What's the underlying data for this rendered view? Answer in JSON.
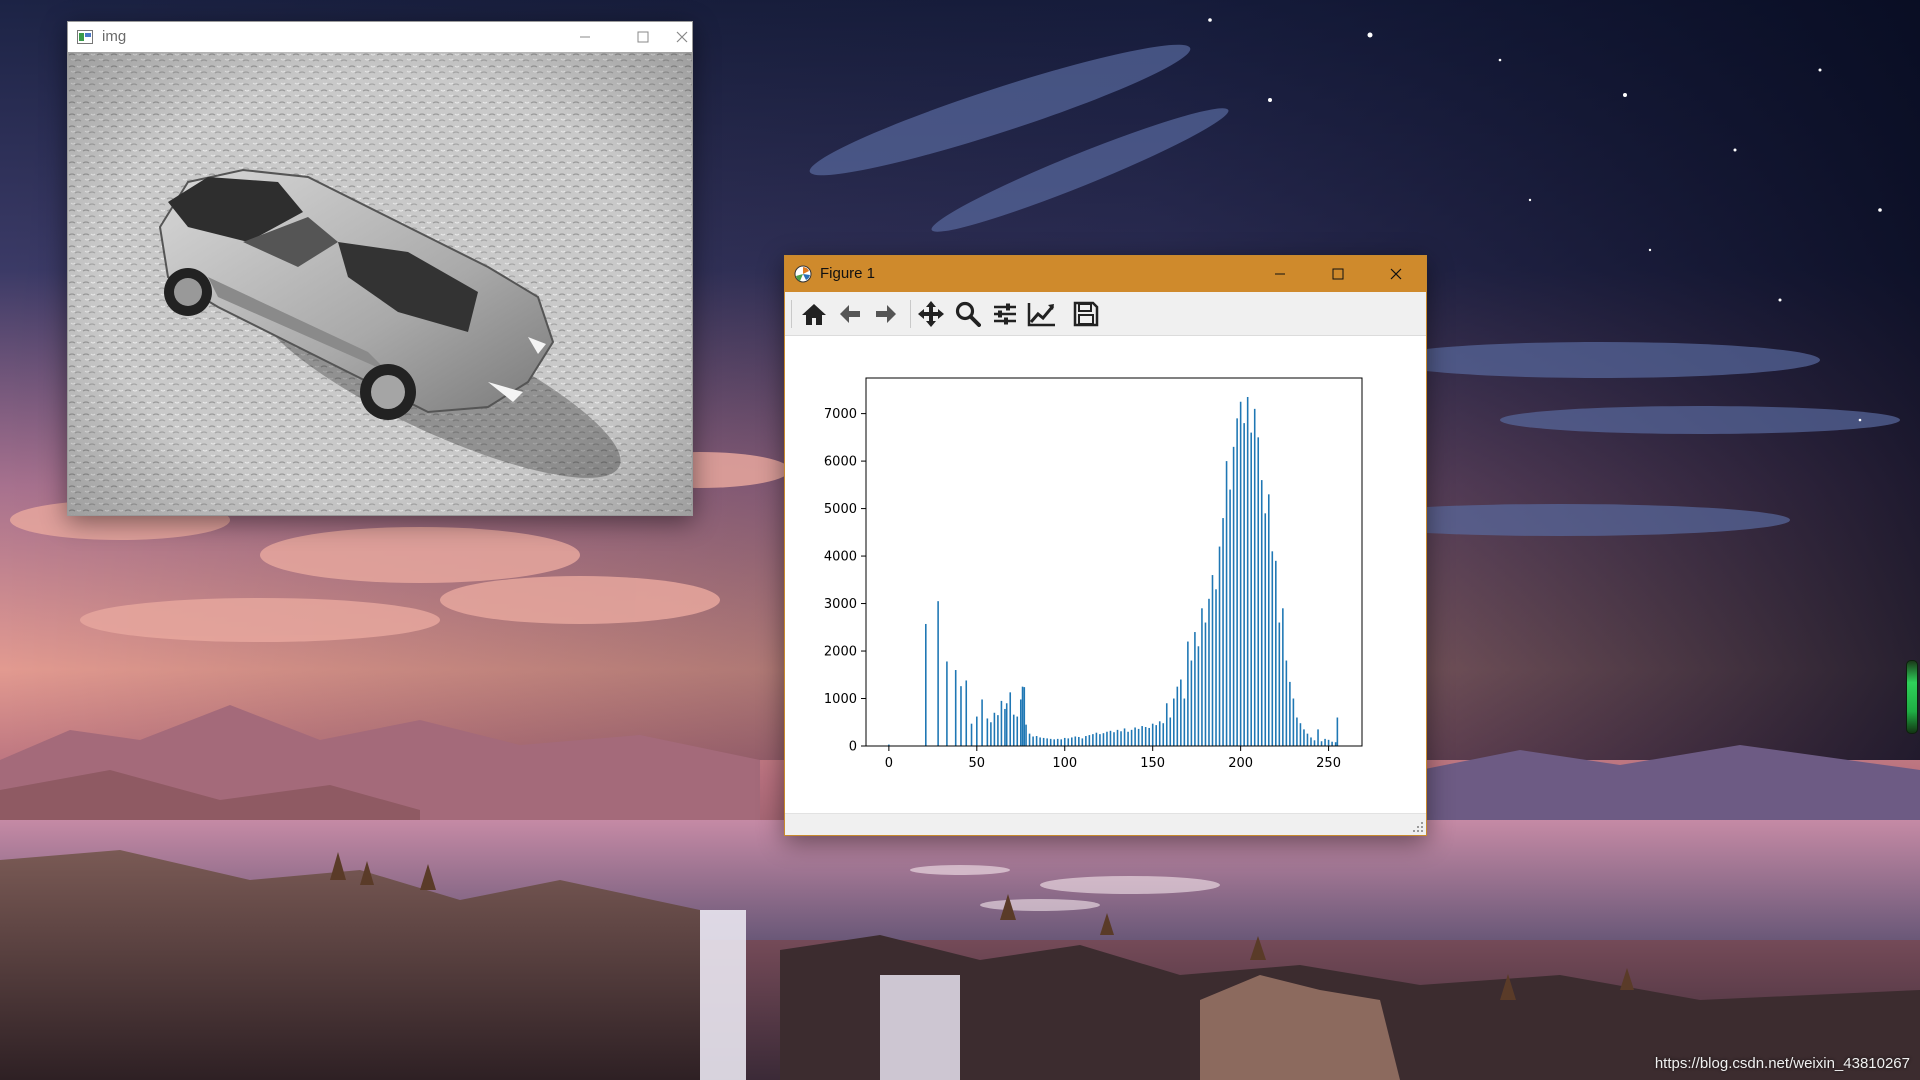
{
  "desktop": {
    "watermark": "https://blog.csdn.net/weixin_43810267"
  },
  "img_window": {
    "title": "img",
    "title_icon": "opencv-window-icon",
    "image_description_icon": "grayscale-sports-car-photo"
  },
  "figure_window": {
    "title": "Figure 1",
    "title_icon": "matplotlib-icon",
    "titlebar_color": "#cf8a2c",
    "toolbar": [
      {
        "icon": "home-icon"
      },
      {
        "icon": "back-arrow-icon"
      },
      {
        "icon": "forward-arrow-icon"
      },
      {
        "icon": "pan-move-icon"
      },
      {
        "icon": "zoom-magnifier-icon"
      },
      {
        "icon": "configure-subplots-icon"
      },
      {
        "icon": "edit-axis-icon"
      },
      {
        "icon": "save-floppy-icon"
      }
    ]
  },
  "chart_data": {
    "type": "bar",
    "title": "",
    "xlabel": "",
    "ylabel": "",
    "xlim": [
      -13,
      269
    ],
    "ylim": [
      0,
      7750
    ],
    "xticks": [
      "0",
      "50",
      "100",
      "150",
      "200",
      "250"
    ],
    "yticks": [
      "0",
      "1000",
      "2000",
      "3000",
      "4000",
      "5000",
      "6000",
      "7000"
    ],
    "bar_color": "#1f77b4",
    "grid": false,
    "legend": "none",
    "bins": [
      [
        0,
        30
      ],
      [
        21,
        2570
      ],
      [
        28,
        3050
      ],
      [
        33,
        1780
      ],
      [
        38,
        1600
      ],
      [
        41,
        1260
      ],
      [
        44,
        1380
      ],
      [
        47,
        470
      ],
      [
        50,
        620
      ],
      [
        53,
        980
      ],
      [
        56,
        580
      ],
      [
        58,
        500
      ],
      [
        60,
        700
      ],
      [
        62,
        650
      ],
      [
        64,
        950
      ],
      [
        66,
        780
      ],
      [
        67,
        900
      ],
      [
        69,
        1130
      ],
      [
        71,
        660
      ],
      [
        73,
        620
      ],
      [
        75,
        980
      ],
      [
        76,
        1250
      ],
      [
        77,
        1240
      ],
      [
        78,
        450
      ],
      [
        80,
        260
      ],
      [
        82,
        200
      ],
      [
        84,
        210
      ],
      [
        86,
        180
      ],
      [
        88,
        170
      ],
      [
        90,
        160
      ],
      [
        92,
        150
      ],
      [
        94,
        140
      ],
      [
        96,
        150
      ],
      [
        98,
        140
      ],
      [
        100,
        170
      ],
      [
        102,
        160
      ],
      [
        104,
        180
      ],
      [
        106,
        200
      ],
      [
        108,
        190
      ],
      [
        110,
        160
      ],
      [
        112,
        210
      ],
      [
        114,
        230
      ],
      [
        116,
        250
      ],
      [
        118,
        280
      ],
      [
        120,
        250
      ],
      [
        122,
        270
      ],
      [
        124,
        300
      ],
      [
        126,
        320
      ],
      [
        128,
        290
      ],
      [
        130,
        340
      ],
      [
        132,
        310
      ],
      [
        134,
        370
      ],
      [
        136,
        300
      ],
      [
        138,
        340
      ],
      [
        140,
        390
      ],
      [
        142,
        360
      ],
      [
        144,
        420
      ],
      [
        146,
        400
      ],
      [
        148,
        380
      ],
      [
        150,
        470
      ],
      [
        152,
        440
      ],
      [
        154,
        520
      ],
      [
        156,
        480
      ],
      [
        158,
        900
      ],
      [
        160,
        600
      ],
      [
        162,
        1000
      ],
      [
        164,
        1250
      ],
      [
        166,
        1400
      ],
      [
        168,
        1000
      ],
      [
        170,
        2200
      ],
      [
        172,
        1800
      ],
      [
        174,
        2400
      ],
      [
        176,
        2100
      ],
      [
        178,
        2900
      ],
      [
        180,
        2600
      ],
      [
        182,
        3100
      ],
      [
        184,
        3600
      ],
      [
        186,
        3300
      ],
      [
        188,
        4200
      ],
      [
        190,
        4800
      ],
      [
        192,
        6000
      ],
      [
        194,
        5400
      ],
      [
        196,
        6300
      ],
      [
        198,
        6900
      ],
      [
        200,
        7250
      ],
      [
        202,
        6800
      ],
      [
        204,
        7350
      ],
      [
        206,
        6600
      ],
      [
        208,
        7100
      ],
      [
        210,
        6500
      ],
      [
        212,
        5600
      ],
      [
        214,
        4900
      ],
      [
        216,
        5300
      ],
      [
        218,
        4100
      ],
      [
        220,
        3900
      ],
      [
        222,
        2600
      ],
      [
        224,
        2900
      ],
      [
        226,
        1800
      ],
      [
        228,
        1350
      ],
      [
        230,
        1000
      ],
      [
        232,
        600
      ],
      [
        234,
        480
      ],
      [
        236,
        350
      ],
      [
        238,
        260
      ],
      [
        240,
        180
      ],
      [
        242,
        120
      ],
      [
        244,
        350
      ],
      [
        246,
        100
      ],
      [
        248,
        150
      ],
      [
        250,
        130
      ],
      [
        252,
        90
      ],
      [
        254,
        80
      ],
      [
        255,
        600
      ]
    ]
  }
}
